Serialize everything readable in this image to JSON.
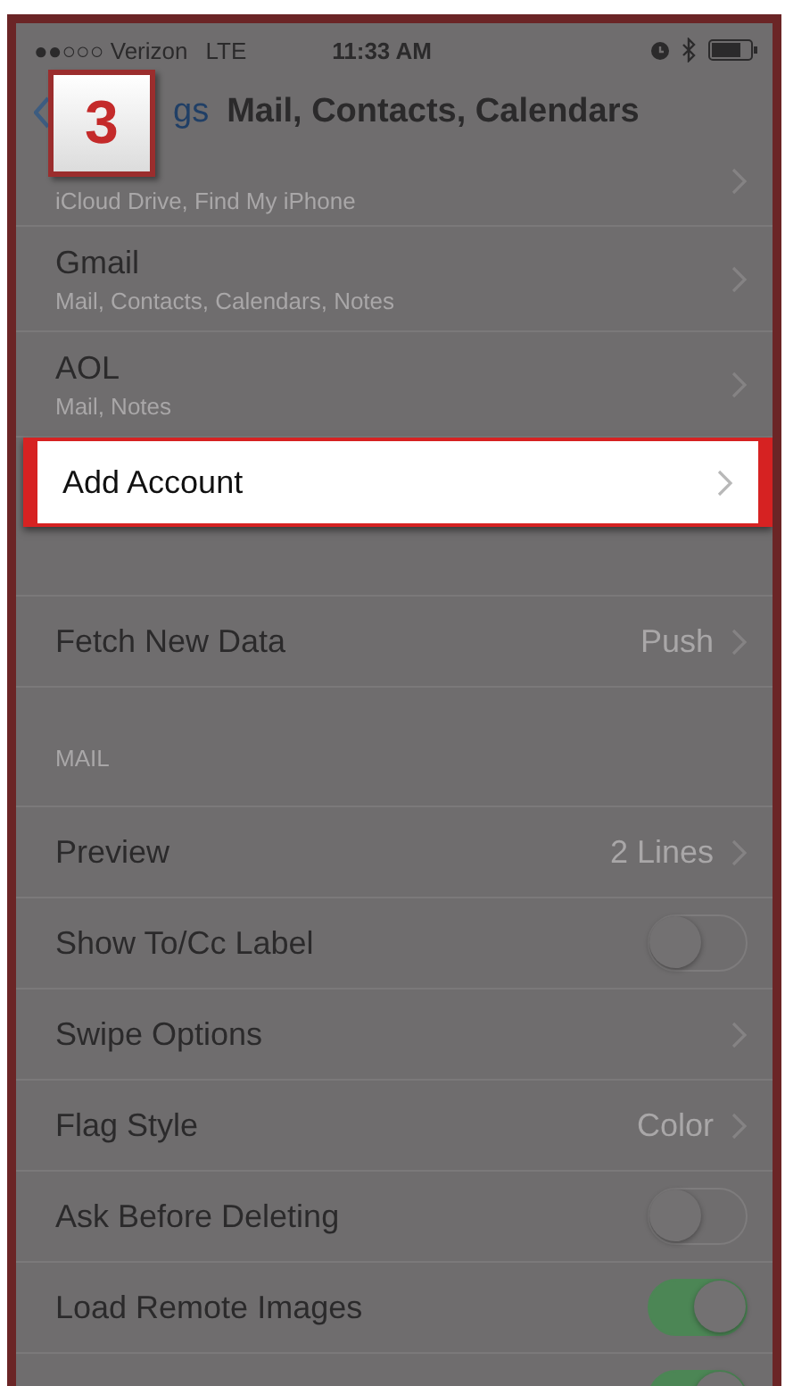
{
  "status_bar": {
    "carrier": "●●○○○ Verizon",
    "network": "LTE",
    "time": "11:33 AM"
  },
  "step_badge": "3",
  "nav": {
    "back_label": "gs",
    "title": "Mail, Contacts, Calendars"
  },
  "accounts": [
    {
      "subtitle": "iCloud Drive, Find My iPhone"
    },
    {
      "title": "Gmail",
      "subtitle": "Mail, Contacts, Calendars, Notes"
    },
    {
      "title": "AOL",
      "subtitle": "Mail, Notes"
    }
  ],
  "add_account": {
    "label": "Add Account",
    "highlighted": true
  },
  "fetch": {
    "label": "Fetch New Data",
    "value": "Push"
  },
  "mail_section": {
    "header": "MAIL",
    "rows": [
      {
        "kind": "value",
        "label": "Preview",
        "value": "2 Lines"
      },
      {
        "kind": "toggle",
        "label": "Show To/Cc Label",
        "on": false
      },
      {
        "kind": "link",
        "label": "Swipe Options"
      },
      {
        "kind": "value",
        "label": "Flag Style",
        "value": "Color"
      },
      {
        "kind": "toggle",
        "label": "Ask Before Deleting",
        "on": false
      },
      {
        "kind": "toggle",
        "label": "Load Remote Images",
        "on": true
      },
      {
        "kind": "toggle",
        "on": true
      }
    ]
  }
}
